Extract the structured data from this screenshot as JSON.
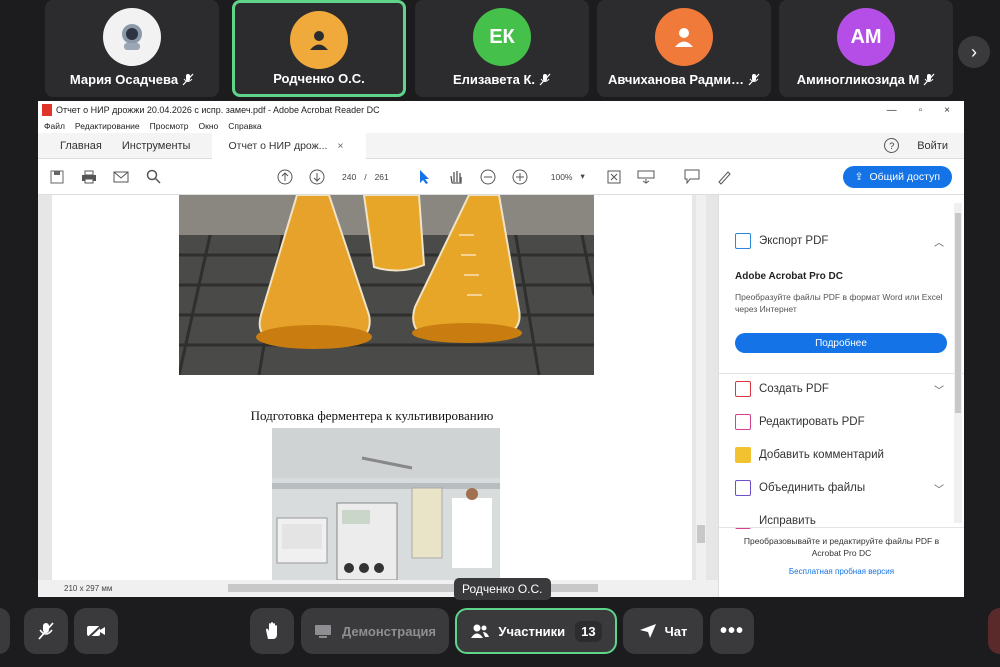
{
  "participants": [
    {
      "name": "Мария Осадчева",
      "initials": "",
      "color": "#f2f2f2",
      "muted": true,
      "active": false
    },
    {
      "name": "Родченко О.С.",
      "initials": "",
      "color": "#f0a93b",
      "muted": false,
      "active": true
    },
    {
      "name": "Елизавета К.",
      "initials": "ЕК",
      "color": "#45c04a",
      "muted": true,
      "active": false
    },
    {
      "name": "Авчиханова Радми…",
      "initials": "",
      "color": "#f07a3a",
      "muted": true,
      "active": false
    },
    {
      "name": "Аминогликозида М",
      "initials": "АМ",
      "color": "#b54ee6",
      "muted": true,
      "active": false
    }
  ],
  "acrobat": {
    "window_title": "Отчет о НИР дрожжи 20.04.2026 с испр. замеч.pdf - Adobe Acrobat Reader DC",
    "menu": [
      "Файл",
      "Редактирование",
      "Просмотр",
      "Окно",
      "Справка"
    ],
    "tabs": {
      "home": "Главная",
      "tools": "Инструменты",
      "doc": "Отчет о НИР дрож..."
    },
    "signin": "Войти",
    "page_current": "240",
    "page_sep": "/",
    "page_total": "261",
    "zoom": "100%",
    "share": "Общий доступ",
    "caption": "Подготовка ферментера к культивированию",
    "page_size": "210 x 297 мм",
    "panel": {
      "export": "Экспорт PDF",
      "promo_title": "Adobe Acrobat Pro DC",
      "promo_text": "Преобразуйте файлы PDF в формат Word или Excel через Интернет",
      "promo_button": "Подробнее",
      "create": "Создать PDF",
      "edit": "Редактировать PDF",
      "comment": "Добавить комментарий",
      "combine": "Объединить файлы",
      "fix": "Исправить",
      "footer": "Преобразовывайте и редактируйте файлы PDF в Acrobat Pro DC",
      "trial": "Бесплатная пробная версия"
    }
  },
  "tooltip": "Родченко О.С.",
  "controls": {
    "screen_share": "Демонстрация",
    "participants": "Участники",
    "participants_count": "13",
    "chat": "Чат"
  }
}
